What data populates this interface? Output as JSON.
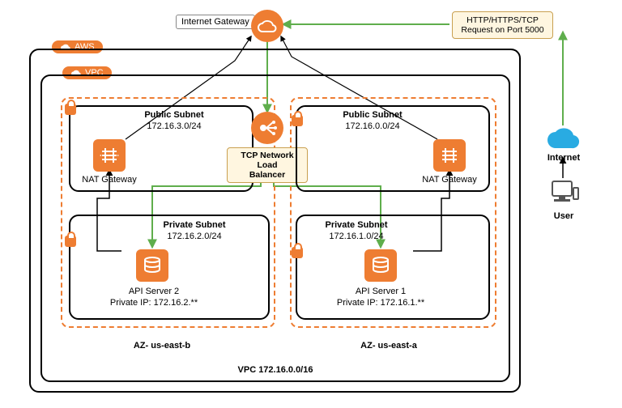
{
  "diagram": {
    "type": "aws-architecture",
    "request_label": "HTTP/HTTPS/TCP\nRequest on Port 5000",
    "internet_gateway": "Internet Gateway",
    "aws_badge": "AWS",
    "vpc_badge": "VPC",
    "load_balancer": "TCP Network Load\nBalancer",
    "vpc_footer": "VPC 172.16.0.0/16",
    "availability_zones": [
      {
        "name": "AZ- us-east-b",
        "public_subnet": {
          "title": "Public Subnet",
          "cidr": "172.16.3.0/24",
          "nat": "NAT Gateway"
        },
        "private_subnet": {
          "title": "Private Subnet",
          "cidr": "172.16.2.0/24",
          "server": "API Server 2",
          "ip": "Private IP: 172.16.2.**"
        }
      },
      {
        "name": "AZ- us-east-a",
        "public_subnet": {
          "title": "Public Subnet",
          "cidr": "172.16.0.0/24",
          "nat": "NAT Gateway"
        },
        "private_subnet": {
          "title": "Private Subnet",
          "cidr": "172.16.1.0/24",
          "server": "API Server 1",
          "ip": "Private IP: 172.16.1.**"
        }
      }
    ],
    "internet_label": "Internet",
    "user_label": "User"
  },
  "colors": {
    "orange": "#ee7d32",
    "blue": "#29abe2",
    "green": "#5fae4c"
  }
}
